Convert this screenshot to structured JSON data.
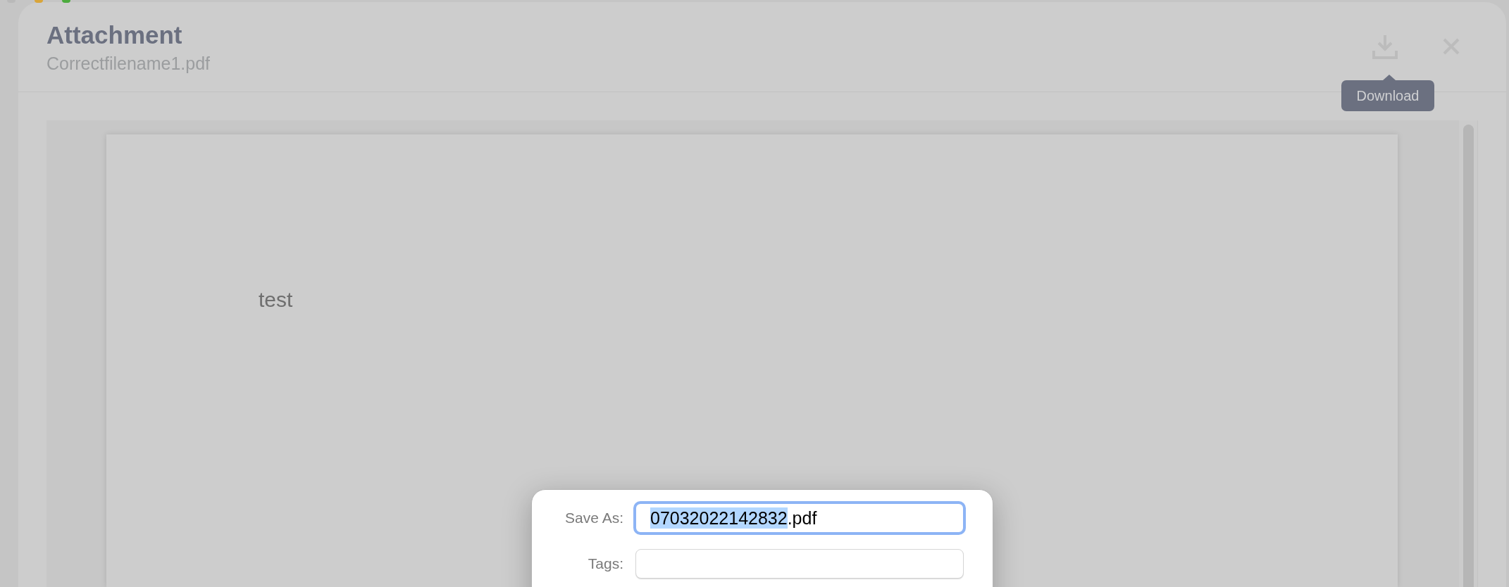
{
  "window": {
    "title": "Attachment",
    "subtitle": "Correctfilename1.pdf"
  },
  "tooltip": {
    "text": "Download"
  },
  "document": {
    "lines": [
      "test"
    ]
  },
  "save_dialog": {
    "fields": [
      {
        "label": "Save As:",
        "focused": true,
        "value_parts": [
          {
            "text": "07032022142832",
            "selected": true
          },
          {
            "text": ".pdf",
            "selected": false
          }
        ]
      },
      {
        "label": "Tags:",
        "focused": false
      }
    ]
  }
}
